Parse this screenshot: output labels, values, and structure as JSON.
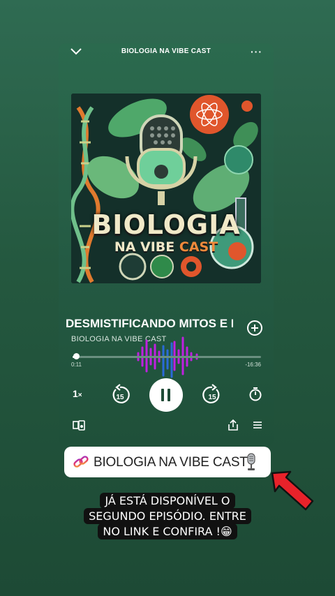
{
  "player": {
    "header_title": "BIOLOGIA NA VIBE CAST",
    "more_label": "···",
    "art_title_line1": "BIOLOGIA",
    "art_title_line2a": "NA VIBE ",
    "art_title_line2b": "CAST",
    "episode_title": "DESMISTIFICANDO MITOS E ERROS",
    "show_name": "BIOLOGIA NA VIBE CAST",
    "elapsed": "0:11",
    "remaining": "-16:36",
    "progress_fraction": 0.02,
    "speed_label": "1",
    "speed_suffix": "×",
    "skip_back_label": "15",
    "skip_forward_label": "15"
  },
  "link_sticker": {
    "label": "BIOLOGIA NA VIBE CAST"
  },
  "caption": {
    "line1": "JÁ ESTÁ DISPONÍVEL O",
    "line2": "SEGUNDO EPISÓDIO. ENTRE",
    "line3": "NO LINK E CONFIRA !😁"
  },
  "colors": {
    "background": "#26593f",
    "arrow": "#e8222a",
    "waveform": "#c020e0"
  }
}
